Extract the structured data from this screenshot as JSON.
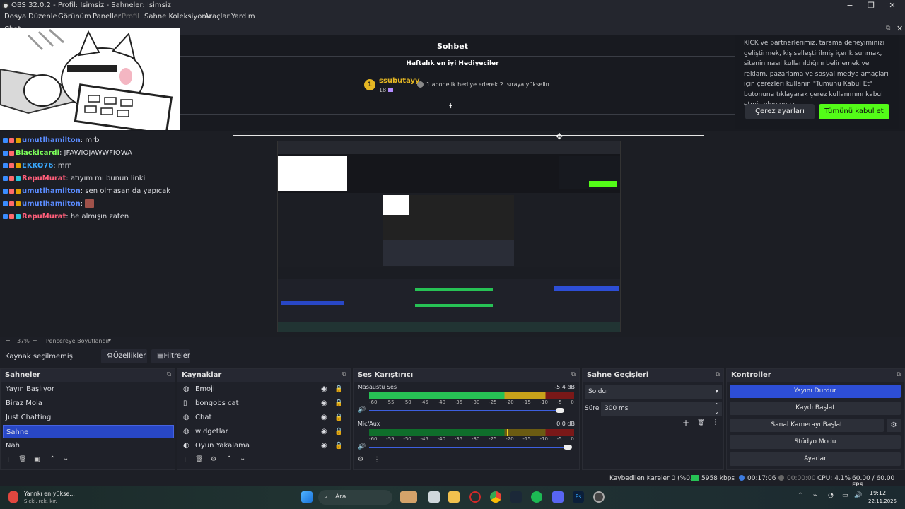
{
  "window": {
    "title": "OBS 32.0.2 - Profil: İsimsiz - Sahneler: İsimsiz",
    "min": "−",
    "max": "❐",
    "close": "✕"
  },
  "menu": [
    "Dosya",
    "Düzenle",
    "Görünüm",
    "Paneller",
    "Profil",
    "Sahne Koleksiyonu",
    "Araçlar",
    "Yardım"
  ],
  "chat_dock": {
    "title": "Chat",
    "kick_header": "Sohbet",
    "gifters_title": "Haftalık en iyi Hediyeciler",
    "gifter_rank": "1",
    "gifter_name": "ssubutayy",
    "gifter_count": "18",
    "gift_msg": "1 abonelik hediye ederek 2. sıraya yükselin",
    "cookie_text": "KICK ve partnerlerimiz, tarama deneyiminizi geliştirmek, kişiselleştirilmiş içerik sunmak, sitenin nasıl kullanıldığını belirlemek ve reklam, pazarlama ve sosyal medya amaçları için çerezleri kullanır. \"Tümünü Kabul Et\" butonuna tıklayarak çerez kullanımını kabul etmiş olursunuz.",
    "cookie_settings": "Çerez ayarları",
    "cookie_accept": "Tümünü kabul et",
    "messages": [
      {
        "user": "umutlhamilton",
        "color": "#5b8cff",
        "text": ": mrb"
      },
      {
        "user": "Blackicardi",
        "color": "#7cff5a",
        "text": ": JFAWIOJAWWFIOWA"
      },
      {
        "user": "EKKO76",
        "color": "#39a9ff",
        "text": ": mrn"
      },
      {
        "user": "RepuMurat",
        "color": "#ff5e7a",
        "text": ": atıyım mı bunun linki"
      },
      {
        "user": "umutlhamilton",
        "color": "#5b8cff",
        "text": ": sen olmasan da yapıcak"
      },
      {
        "user": "umutlhamilton",
        "color": "#5b8cff",
        "text": ": "
      },
      {
        "user": "RepuMurat",
        "color": "#ff5e7a",
        "text": ": he almışın zaten"
      }
    ]
  },
  "zoom": {
    "value": "37%",
    "mode": "Pencereye Boyutlandır"
  },
  "source_bar": {
    "status": "Kaynak seçilmemiş",
    "properties": "Özellikler",
    "filters": "Filtreler"
  },
  "scenes": {
    "title": "Sahneler",
    "items": [
      "Yayın Başlıyor",
      "Biraz Mola",
      "Just Chatting",
      "Sahne",
      "Nah"
    ],
    "selected": 3
  },
  "sources": {
    "title": "Kaynaklar",
    "items": [
      "Emoji",
      "bongobs cat",
      "Chat",
      "widgetlar",
      "Oyun Yakalama"
    ]
  },
  "mixer": {
    "title": "Ses Karıştırıcı",
    "channels": [
      {
        "name": "Masaüstü Ses",
        "db": "-5.4 dB",
        "level": 0.93
      },
      {
        "name": "Mic/Aux",
        "db": "0.0 dB",
        "level": 0.97
      }
    ],
    "scale": [
      "-60",
      "-55",
      "-50",
      "-45",
      "-40",
      "-35",
      "-30",
      "-25",
      "-20",
      "-15",
      "-10",
      "-5",
      "0"
    ]
  },
  "transitions": {
    "title": "Sahne Geçişleri",
    "type": "Soldur",
    "duration_label": "Süre",
    "duration": "300 ms"
  },
  "controls": {
    "title": "Kontroller",
    "buttons": [
      "Yayını Durdur",
      "Kaydı Başlat",
      "Sanal Kamerayı Başlat",
      "Stüdyo Modu",
      "Ayarlar"
    ]
  },
  "status": {
    "dropped": "Kaybedilen Kareler 0 (%0.0)",
    "bitrate": "5958 kbps",
    "stream_time": "00:17:06",
    "rec_time": "00:00:00",
    "cpu": "CPU: 4.1%",
    "fps": "60.00 / 60.00 FPS"
  },
  "taskbar": {
    "weather_title": "Yannkı en yükse...",
    "weather_sub": "Sıckl. rek. kır.",
    "search": "Ara",
    "time": "19:12",
    "date": "22.11.2025"
  },
  "colors": {
    "accent": "#2d4ed6",
    "kick_green": "#53fc18"
  }
}
